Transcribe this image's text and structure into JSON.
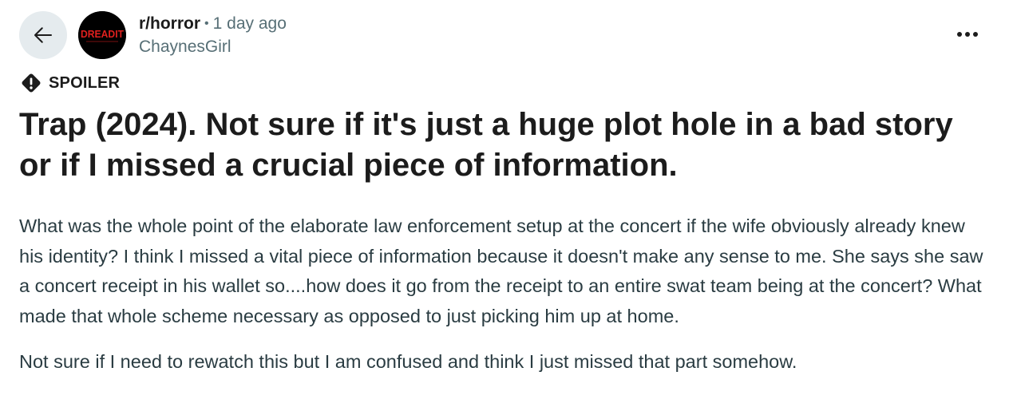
{
  "header": {
    "back_icon": "arrow-left-icon",
    "subreddit_icon_text": "DREADIT",
    "subreddit": "r/horror",
    "separator": "•",
    "time_ago": "1 day ago",
    "author": "ChaynesGirl",
    "more_icon": "ellipsis-icon"
  },
  "post": {
    "spoiler_label": "SPOILER",
    "title": "Trap (2024). Not sure if it's just a huge plot hole in a bad story or if I missed a crucial piece of information.",
    "paragraphs": [
      "What was the whole point of the elaborate law enforcement setup at the concert if the wife obviously already knew his identity? I think I missed a vital piece of information because it doesn't make any sense to me. She says she saw a concert receipt in his wallet so....how does it go from the receipt to an entire swat team being at the concert? What made that whole scheme necessary as opposed to just picking him up at home.",
      "Not sure if I need to rewatch this but I am confused and think I just missed that part somehow."
    ]
  },
  "colors": {
    "back_button_bg": "#e5ebee",
    "subreddit_icon_bg": "#000000",
    "subreddit_icon_text": "#e0201e",
    "muted_text": "#576f76",
    "body_text": "#2a3c42"
  }
}
